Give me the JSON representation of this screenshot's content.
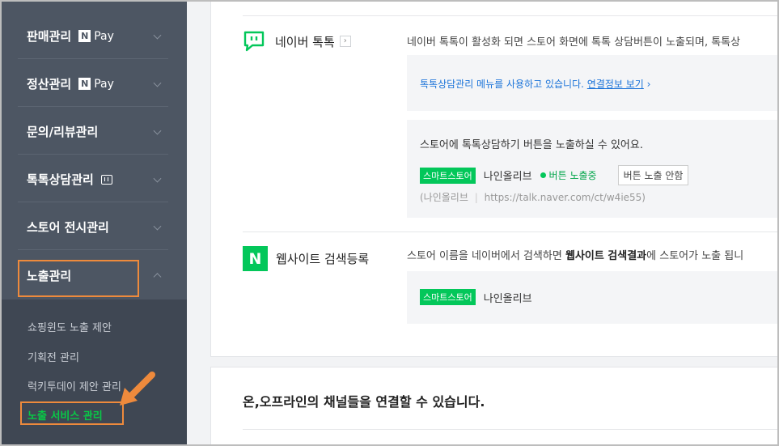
{
  "sidebar": {
    "items": [
      {
        "label": "판매관리",
        "badge": "Pay"
      },
      {
        "label": "정산관리",
        "badge": "Pay"
      },
      {
        "label": "문의/리뷰관리"
      },
      {
        "label": "톡톡상담관리"
      },
      {
        "label": "스토어 전시관리"
      },
      {
        "label": "노출관리"
      }
    ],
    "submenu": [
      "쇼핑윈도 노출 제안",
      "기획전 관리",
      "럭키투데이 제안 관리",
      "노출 서비스 관리"
    ]
  },
  "talktalk": {
    "title": "네이버 톡톡",
    "link_icon": "›",
    "desc": "네이버 톡톡이 활성화 되면 스토어 화면에 톡톡 상담버튼이 노출되며, 톡톡상",
    "notice": "톡톡상담관리 메뉴를 사용하고 있습니다.",
    "notice_link": "연결정보 보기",
    "notice_arrow": "›",
    "box_title": "스토어에 톡톡상담하기 버튼을 노출하실 수 있어요.",
    "tag": "스마트스토어",
    "store": "나인올리브",
    "status": "버튼 노출중",
    "hide_button": "버튼 노출 안함",
    "sub_store": "(나인올리브",
    "sep": "|",
    "url": "https://talk.naver.com/ct/w4ie55)"
  },
  "website": {
    "title": "웹사이트 검색등록",
    "logo": "N",
    "desc_pre": "스토어 이름을 네이버에서 검색하면 ",
    "desc_bold": "웹사이트 검색결과",
    "desc_post": "에 스토어가 노출 됩니",
    "tag": "스마트스토어",
    "store": "나인올리브"
  },
  "channels": {
    "text": "온,오프라인의 채널들을 연결할 수 있습니다."
  },
  "colors": {
    "accent_green": "#03c75a",
    "highlight_orange": "#ee8a3c",
    "sidebar_bg": "#4d5663"
  }
}
